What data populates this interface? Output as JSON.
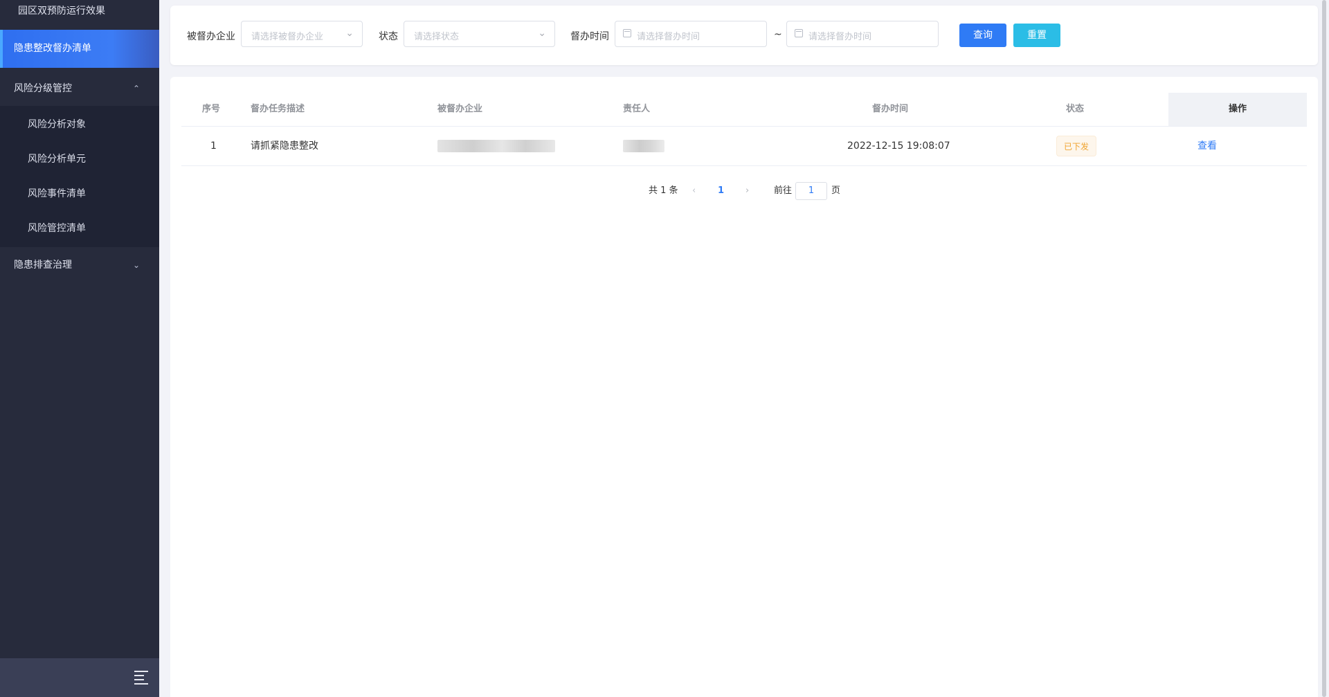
{
  "sidebar": {
    "top_item": "园区双预防运行效果",
    "active_item": "隐患整改督办清单",
    "groups": [
      {
        "label": "风险分级管控",
        "chevron": "chevron-up-icon"
      },
      {
        "label": "隐患排查治理",
        "chevron": "chevron-down-icon"
      }
    ],
    "sub_items": [
      "风险分析对象",
      "风险分析单元",
      "风险事件清单",
      "风险管控清单"
    ],
    "collapse_icon": "menu-fold-icon"
  },
  "filters": {
    "company_label": "被督办企业",
    "company_placeholder": "请选择被督办企业",
    "status_label": "状态",
    "status_placeholder": "请选择状态",
    "time_label": "督办时间",
    "start_placeholder": "请选择督办时间",
    "separator": "~",
    "end_placeholder": "请选择督办时间",
    "query_button": "查询",
    "reset_button": "重置"
  },
  "table": {
    "columns": [
      "序号",
      "督办任务描述",
      "被督办企业",
      "责任人",
      "督办时间",
      "状态",
      "操作"
    ],
    "rows": [
      {
        "index": "1",
        "description": "请抓紧隐患整改",
        "time": "2022-12-15 19:08:07",
        "status": "已下发",
        "action": "查看"
      }
    ]
  },
  "pagination": {
    "total": "共 1 条",
    "current_page": "1",
    "goto_label": "前往",
    "goto_value": "1",
    "page_suffix": "页"
  },
  "colors": {
    "sidebar_bg": "#272b3c",
    "active_item": "#2f6ff0",
    "primary": "#2f7bf5",
    "reset_button": "#2bbde6",
    "status_warning": "#f0a431"
  }
}
